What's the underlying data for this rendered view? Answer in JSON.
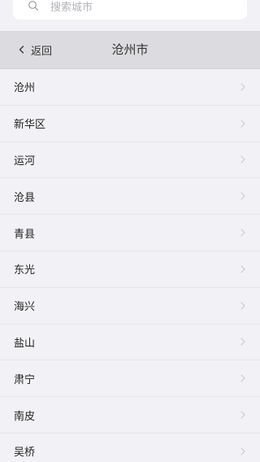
{
  "search": {
    "placeholder": "搜索城市"
  },
  "header": {
    "back_label": "返回",
    "title": "沧州市"
  },
  "districts": [
    "沧州",
    "新华区",
    "运河",
    "沧县",
    "青县",
    "东光",
    "海兴",
    "盐山",
    "肃宁",
    "南皮",
    "吴桥"
  ],
  "icons": {
    "search": "search-icon",
    "back": "chevron-left-icon",
    "row": "chevron-right-icon"
  },
  "colors": {
    "background": "#f2f2f6",
    "header": "#dcdce0",
    "chevron": "#c7c7cc"
  }
}
